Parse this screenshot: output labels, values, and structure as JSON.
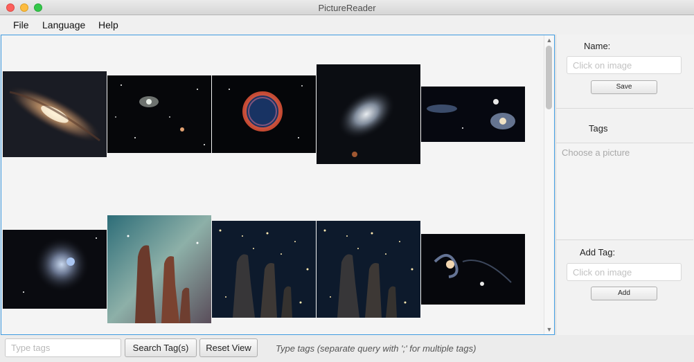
{
  "window": {
    "title": "PictureReader"
  },
  "menu": {
    "file": "File",
    "language": "Language",
    "help": "Help"
  },
  "sidebar": {
    "name_label": "Name:",
    "name_placeholder": "Click on image",
    "save_label": "Save",
    "tags_label": "Tags",
    "tags_empty": "Choose a picture",
    "add_tag_label": "Add Tag:",
    "add_tag_placeholder": "Click on image",
    "add_label": "Add"
  },
  "bottom": {
    "search_placeholder": "Type tags",
    "search_button": "Search Tag(s)",
    "reset_button": "Reset View",
    "hint": "Type tags (separate query with ';' for multiple tags)"
  },
  "gallery": {
    "images": [
      "spiral-galaxy-image",
      "comet-starfield-image",
      "supernova-remnant-image",
      "irregular-galaxy-image",
      "interacting-galaxies-image",
      "dwarf-galaxy-image",
      "pillars-of-creation-image",
      "pillars-infrared-image",
      "pillars-infrared-duplicate-image",
      "merging-galaxy-image"
    ]
  },
  "colors": {
    "focus_accent": "#3c9ae0"
  }
}
